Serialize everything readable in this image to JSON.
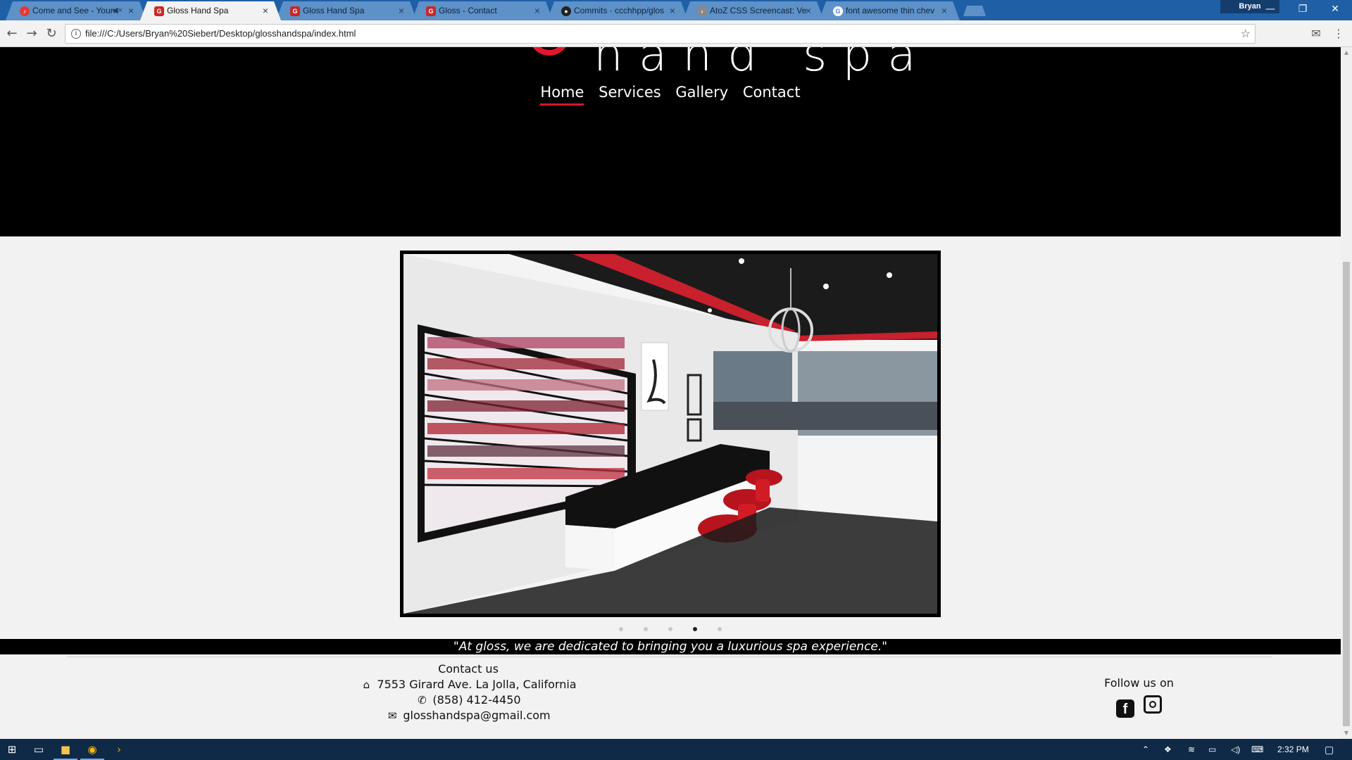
{
  "browser": {
    "tabs": [
      {
        "title": "Come and See - Youn",
        "favicon_color": "#e53935",
        "muted": true,
        "active": false
      },
      {
        "title": "Gloss Hand Spa",
        "favicon_color": "#c62828",
        "muted": false,
        "active": true
      },
      {
        "title": "Gloss Hand Spa",
        "favicon_color": "#c62828",
        "muted": false,
        "active": false
      },
      {
        "title": "Gloss - Contact",
        "favicon_color": "#c62828",
        "muted": false,
        "active": false
      },
      {
        "title": "Commits · ccchhpp/glos",
        "favicon_color": "#222222",
        "muted": false,
        "active": false
      },
      {
        "title": "AtoZ CSS Screencast: Ve",
        "favicon_color": "#888888",
        "muted": false,
        "active": false
      },
      {
        "title": "font awesome thin chev",
        "favicon_color": "#4285f4",
        "muted": false,
        "active": false
      }
    ],
    "profile_name": "Bryan",
    "url": "file:///C:/Users/Bryan%20Siebert/Desktop/glosshandspa/index.html"
  },
  "site": {
    "logo_text": "hand spa",
    "brand_color": "#d3182a",
    "nav": [
      {
        "label": "Home",
        "current": true
      },
      {
        "label": "Services",
        "current": false
      },
      {
        "label": "Gallery",
        "current": false
      },
      {
        "label": "Contact",
        "current": false
      }
    ],
    "carousel": {
      "slide_alt": "Gloss Hand Spa salon interior",
      "dot_count": 5,
      "active_index": 3
    },
    "tagline": "\"At gloss, we are dedicated to bringing you a luxurious spa experience.\"",
    "contact": {
      "heading": "Contact us",
      "address": "7553 Girard Ave. La Jolla, California",
      "phone": "(858) 412-4450",
      "email": "glosshandspa@gmail.com"
    },
    "follow": {
      "heading": "Follow us on",
      "networks": [
        "facebook-icon",
        "instagram-icon"
      ]
    }
  },
  "taskbar": {
    "time": "2:32 PM"
  }
}
